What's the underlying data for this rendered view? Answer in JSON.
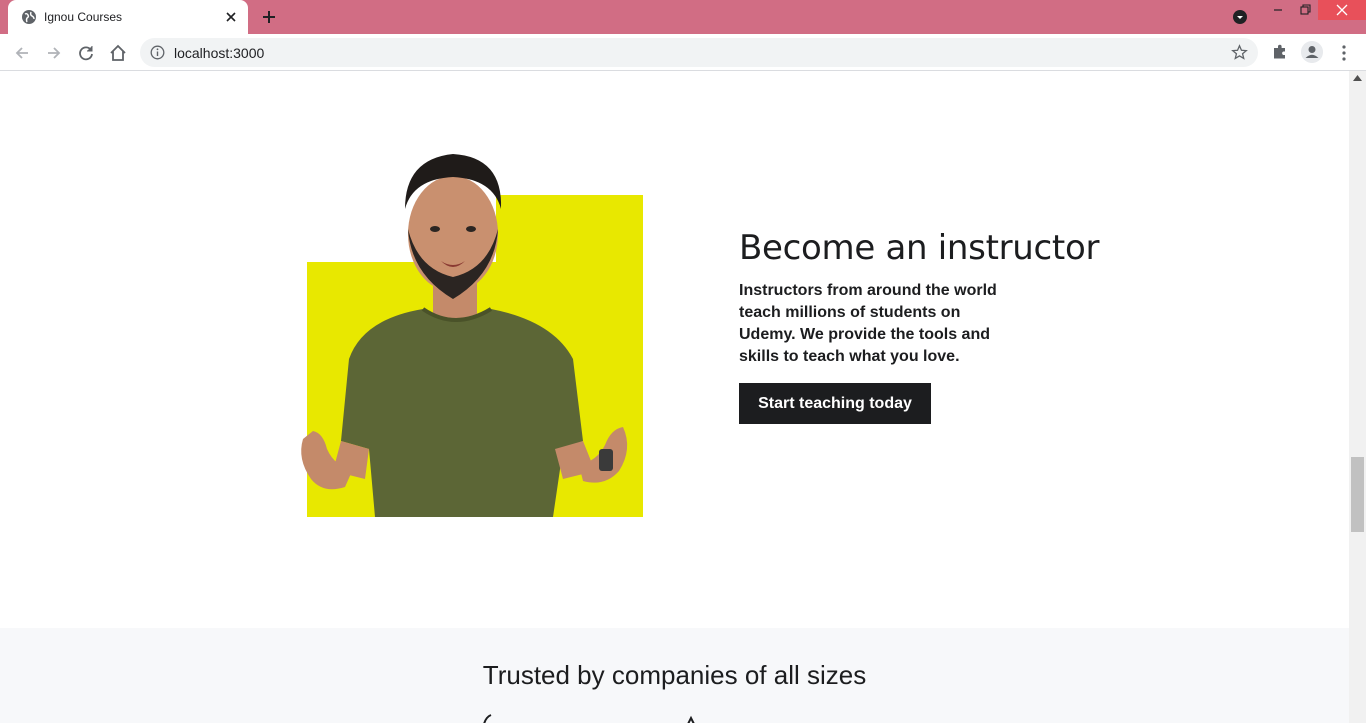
{
  "browser": {
    "tab_title": "Ignou Courses",
    "url": "localhost:3000",
    "tab_bar_color": "#d16d84"
  },
  "icons": {
    "tab_favicon": "globe-icon",
    "tab_close": "close-icon",
    "new_tab": "plus-icon",
    "tab_search": "chevron-down-icon",
    "back": "arrow-left-icon",
    "forward": "arrow-right-icon",
    "reload": "reload-icon",
    "home": "home-icon",
    "site_info": "info-icon",
    "bookmark": "star-icon",
    "extensions": "puzzle-icon",
    "profile": "person-icon",
    "menu": "dots-vertical-icon"
  },
  "hero": {
    "title": "Become an instructor",
    "description": "Instructors from around the world teach millions of students on Udemy. We provide the tools and skills to teach what you love.",
    "button_label": "Start teaching today",
    "accent_color": "#e8e800"
  },
  "trusted": {
    "title": "Trusted by companies of all sizes"
  }
}
